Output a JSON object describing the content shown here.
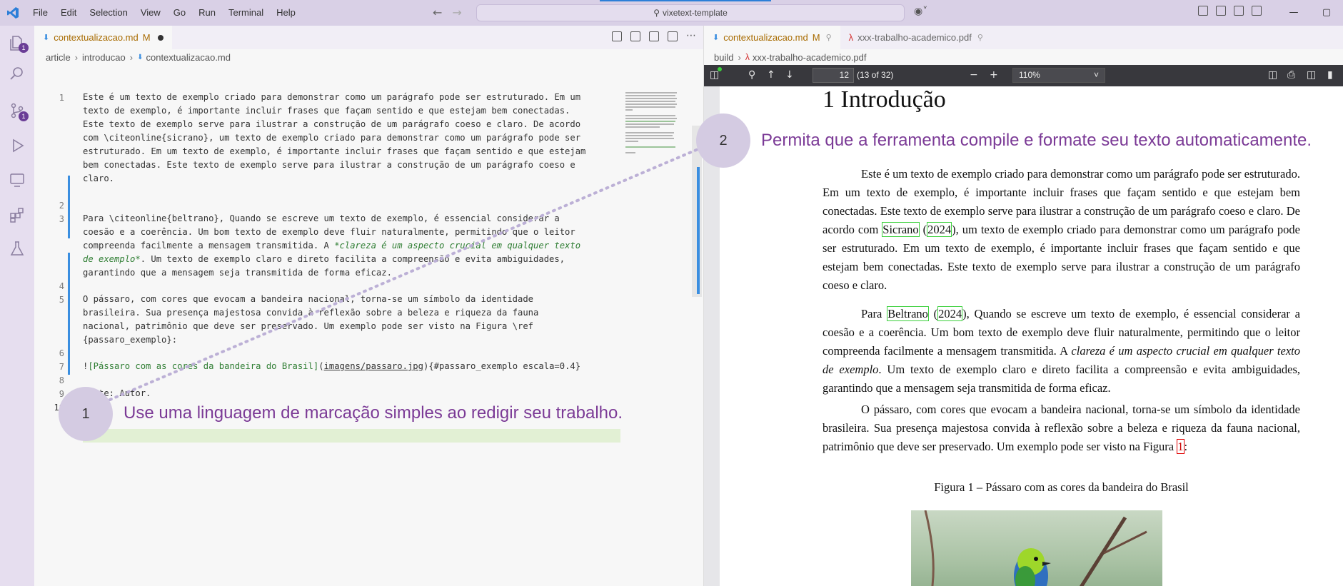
{
  "menu": [
    "File",
    "Edit",
    "Selection",
    "View",
    "Go",
    "Run",
    "Terminal",
    "Help"
  ],
  "command_center": "vixetext-template",
  "window_controls": [
    "—",
    "▢"
  ],
  "activity": {
    "scm_badge": "1",
    "explorer_badge": "1"
  },
  "editor": {
    "tab_name": "contextualizacao.md",
    "tab_status": "M",
    "breadcrumb": [
      "article",
      "introducao",
      "contextualizacao.md"
    ],
    "lines": [
      {
        "n": "1",
        "text": "Este é um texto de exemplo criado para demonstrar como um parágrafo pode ser estruturado. Em um"
      },
      {
        "n": "",
        "text": "texto de exemplo, é importante incluir frases que façam sentido e que estejam bem conectadas."
      },
      {
        "n": "",
        "text": "Este texto de exemplo serve para ilustrar a construção de um parágrafo coeso e claro. De acordo"
      },
      {
        "n": "",
        "text": "com \\citeonline{sicrano}, um texto de exemplo criado para demonstrar como um parágrafo pode ser"
      },
      {
        "n": "",
        "text": "estruturado. Em um texto de exemplo, é importante incluir frases que façam sentido e que estejam"
      },
      {
        "n": "",
        "text": "bem conectadas. Este texto de exemplo serve para ilustrar a construção de um parágrafo coeso e"
      },
      {
        "n": "",
        "text": "claro."
      },
      {
        "n": "2",
        "text": ""
      },
      {
        "n": "3",
        "text": "Para \\citeonline{beltrano}, Quando se escreve um texto de exemplo, é essencial considerar a"
      },
      {
        "n": "",
        "text": "coesão e a coerência. Um bom texto de exemplo deve fluir naturalmente, permitindo que o leitor"
      },
      {
        "n": "",
        "text": "compreenda facilmente a mensagem transmitida. A "
      },
      {
        "n": "",
        "text": ". Um texto de exemplo claro e direto facilita a compreensão e evita ambiguidades,"
      },
      {
        "n": "",
        "text": "garantindo que a mensagem seja transmitida de forma eficaz."
      },
      {
        "n": "4",
        "text": ""
      },
      {
        "n": "5",
        "text": "O pássaro, com cores que evocam a bandeira nacional, torna-se um símbolo da identidade"
      },
      {
        "n": "",
        "text": "brasileira. Sua presença majestosa convida à reflexão sobre a beleza e riqueza da fauna"
      },
      {
        "n": "",
        "text": "nacional, patrimônio que deve ser preservado. Um exemplo pode ser visto na Figura \\ref"
      },
      {
        "n": "",
        "text": "{passaro_exemplo}:"
      },
      {
        "n": "6",
        "text": ""
      },
      {
        "n": "7",
        "text": ""
      },
      {
        "n": "8",
        "text": ""
      },
      {
        "n": "9",
        "text": "Fonte: Autor."
      },
      {
        "n": "10",
        "text": ""
      }
    ],
    "em_text_1": "*clareza é um aspecto crucial em qualquer texto",
    "em_text_2": "de exemplo*",
    "img_line": {
      "bang": "!",
      "alt": "[Pássaro com as cores da bandeira do Brasil]",
      "open": "(",
      "path": "imagens/passaro.jpg",
      "close": ")",
      "attrs": "{#passaro_exemplo escala=0.4}"
    }
  },
  "right": {
    "tab1_name": "contextualizacao.md",
    "tab1_status": "M",
    "tab2_name": "xxx-trabalho-academico.pdf",
    "breadcrumb": [
      "build",
      "xxx-trabalho-academico.pdf"
    ],
    "page_number": "12",
    "page_count": "(13 of 32)",
    "zoom": "110%"
  },
  "pdf": {
    "heading": "1  Introdução",
    "p1_a": "Este é um texto de exemplo criado para demonstrar como um parágrafo pode ser estruturado. Em um texto de exemplo, é importante incluir frases que façam sentido e que estejam bem conectadas. Este texto de exemplo serve para ilustrar a construção de um parágrafo coeso e claro. De acordo com ",
    "p1_cite": "Sicrano",
    "p1_year": "2024",
    "p1_b": "), um texto de exemplo criado para demonstrar como um parágrafo pode ser estruturado. Em um texto de exemplo, é importante incluir frases que façam sentido e que estejam bem conectadas. Este texto de exemplo serve para ilustrar a construção de um parágrafo coeso e claro.",
    "p2_a": "Para ",
    "p2_cite": "Beltrano",
    "p2_year": "2024",
    "p2_b": "), Quando se escreve um texto de exemplo, é essencial considerar a coesão e a coerência. Um bom texto de exemplo deve fluir naturalmente, permitindo que o leitor compreenda facilmente a mensagem transmitida. A ",
    "p2_em": "clareza é um aspecto crucial em qualquer texto de exemplo",
    "p2_c": ". Um texto de exemplo claro e direto facilita a compreensão e evita ambiguidades, garantindo que a mensagem seja transmitida de forma eficaz.",
    "p3_a": "O pássaro, com cores que evocam a bandeira nacional, torna-se um símbolo da identidade brasileira. Sua presença majestosa convida à reflexão sobre a beleza e riqueza da fauna nacional, patrimônio que deve ser preservado. Um exemplo pode ser visto na Figura ",
    "p3_ref": "1",
    "p3_b": ":",
    "figure_caption": "Figura 1 – Pássaro com as cores da bandeira do Brasil"
  },
  "annotations": [
    {
      "number": "1",
      "text": "Use uma linguagem de marcação simples ao redigir seu trabalho."
    },
    {
      "number": "2",
      "text": "Permita que a ferramenta compile e formate seu texto automaticamente."
    }
  ],
  "colors": {
    "accent": "#6a3d96",
    "callout_text": "#7b3a96",
    "titlebar": "#d9d0e6"
  }
}
